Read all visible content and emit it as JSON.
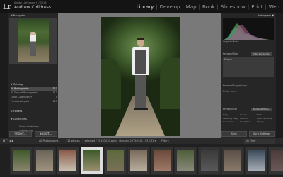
{
  "app": {
    "logo": "Lr",
    "identity_small": "Adobe Lightroom 6 / 2015",
    "identity_name": "Andrew Childress"
  },
  "modules": [
    "Library",
    "Develop",
    "Map",
    "Book",
    "Slideshow",
    "Print",
    "Web"
  ],
  "active_module": "Library",
  "left_panel": {
    "navigator_header": "Navigator",
    "catalog_header": "Catalog",
    "catalog_items": [
      {
        "label": "All Photographs",
        "count": "111",
        "selected": true
      },
      {
        "label": "All Synced Photographs",
        "count": "111"
      },
      {
        "label": "Quick Collection +",
        "count": "0"
      },
      {
        "label": "Previous Import",
        "count": "111"
      }
    ],
    "folders_header": "Folders",
    "collections_header": "Collections",
    "collection_items": [
      "Smart Collections",
      "Stephen Ent"
    ],
    "publish_header": "Publish Services",
    "import_label": "Import...",
    "export_label": "Export..."
  },
  "right_panel": {
    "histogram_header": "Histogram",
    "original_photo": "Original Photo",
    "keyword_tags_label": "Keyword Tags",
    "keyword_tags_mode": "Enter Keywords",
    "keyword_value": "Groom",
    "keyword_suggestions_header": "Keyword Suggestions",
    "keyword_suggestion": "Bridal dance",
    "keyword_set_label": "Keyword Set",
    "keyword_set_value": "Wedding Photo...",
    "keyword_set_items": [
      "Ring",
      "Groom",
      "Bride",
      "Wedding Party",
      "Candid",
      "Black & White",
      "Ceremony",
      "Reception",
      "Family"
    ],
    "sync_label": "Sync",
    "sync_settings_label": "Sync Settings"
  },
  "toolbar": {
    "source": "All Photographs",
    "count_text": "111 photos / 1 selected / 20150410-paula_stephen-20150410-153.CR2 ▾",
    "filter_label": "Filter :",
    "filter_value": "No Filter"
  },
  "filmstrip": {
    "selected_index": 3,
    "thumbs": [
      {
        "top": "#3e5a2a",
        "bottom": "#8d8570"
      },
      {
        "top": "#6a6458",
        "bottom": "#a09380"
      },
      {
        "top": "#8a5a48",
        "bottom": "#c9c2b4"
      },
      {
        "top": "#3d5a2a",
        "bottom": "#9c9070"
      },
      {
        "top": "#5b6a3a",
        "bottom": "#7a7058"
      },
      {
        "top": "#7a6a5a",
        "bottom": "#b8b0a0"
      },
      {
        "top": "#6a4a3a",
        "bottom": "#a07a6a"
      },
      {
        "top": "#4e5e3a",
        "bottom": "#8a8a7a"
      },
      {
        "top": "#3a3a3a",
        "bottom": "#5a5a5a"
      },
      {
        "top": "#5a5048",
        "bottom": "#8a7a6a"
      },
      {
        "top": "#3a4a5a",
        "bottom": "#aab0b8"
      },
      {
        "top": "#4a3a3a",
        "bottom": "#6a5a5a"
      }
    ]
  },
  "colors": {
    "background": "#1e1e1e",
    "panel": "#262626",
    "center": "#797979",
    "selection": "#4a4a4a"
  }
}
